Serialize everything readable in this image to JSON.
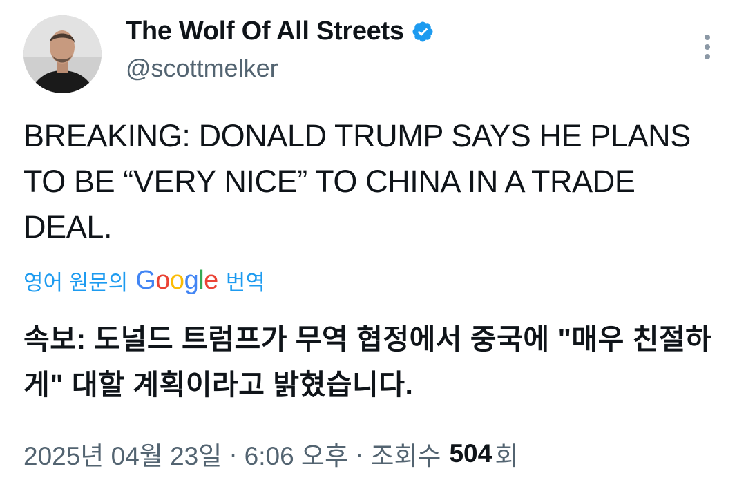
{
  "author": {
    "display_name": "The Wolf Of All Streets",
    "handle": "@scottmelker",
    "verified": true
  },
  "tweet": {
    "text": "BREAKING: DONALD TRUMP SAYS HE PLANS TO BE “VERY NICE” TO CHINA IN A TRADE DEAL."
  },
  "translation": {
    "prefix": "영어 원문의",
    "brand": "Google",
    "suffix": "번역",
    "text": "속보: 도널드 트럼프가 무역 협정에서 중국에 \"매우 친절하게\" 대할 계획이라고 밝혔습니다."
  },
  "meta": {
    "date": "2025년 04월 23일",
    "time": "6:06 오후",
    "separator": "·",
    "views_label": "조회수",
    "views_count": "504",
    "views_suffix": "회"
  },
  "colors": {
    "accent": "#1d9bf0",
    "text_primary": "#0f1419",
    "text_secondary": "#536471"
  },
  "icons": {
    "verified": "verified-badge-icon",
    "more": "more-options-icon"
  }
}
